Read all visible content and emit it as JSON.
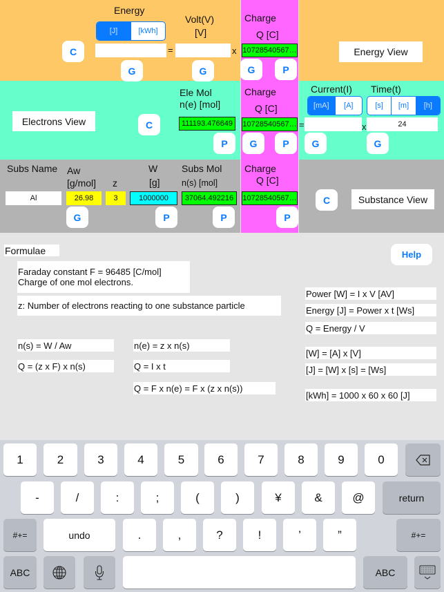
{
  "energy_section": {
    "title": "Energy",
    "unit_toggle": [
      {
        "label": "[J]",
        "selected": true
      },
      {
        "label": "[kWh]",
        "selected": false
      }
    ],
    "energy_value": "",
    "volt_label": "Volt(V)",
    "volt_unit": "[V]",
    "volt_value": "",
    "equals": "=",
    "times": "x",
    "clear_label": "C",
    "get_label": "G",
    "view_button": "Energy View"
  },
  "charge_column": {
    "label": "Charge",
    "unit": "Q [C]",
    "value": "10728540567…",
    "get_label": "G",
    "put_label": "P"
  },
  "electrons_section": {
    "view_button": "Electrons View",
    "clear_label": "C",
    "mol_label": "Ele Mol",
    "mol_unit": "n(e) [mol]",
    "mol_value": "111193.476649",
    "put_label": "P",
    "current_label": "Current(I)",
    "current_toggle": [
      {
        "label": "[mA]",
        "selected": true
      },
      {
        "label": "[A]",
        "selected": false
      }
    ],
    "current_value": "",
    "time_label": "Time(t)",
    "time_toggle": [
      {
        "label": "[s]",
        "selected": false
      },
      {
        "label": "[m]",
        "selected": false
      },
      {
        "label": "[h]",
        "selected": true
      }
    ],
    "time_value": "24",
    "equals": "=",
    "times": "x",
    "get_label": "G"
  },
  "substance_section": {
    "name_label": "Subs Name",
    "name_value": "Al",
    "aw_label": "Aw",
    "aw_unit": "[g/mol]",
    "aw_value": "26.98",
    "z_label": "z",
    "z_value": "3",
    "w_label": "W",
    "w_unit": "[g]",
    "w_value": "1000000",
    "mol_label": "Subs Mol",
    "mol_unit": "n(s) [mol]",
    "mol_value": "37064.492216",
    "get_label": "G",
    "put_label": "P",
    "clear_label": "C",
    "view_button": "Substance View"
  },
  "formulae": {
    "title": "Formulae",
    "help_label": "Help",
    "faraday_line1": "Faraday constant  F = 96485 [C/mol]",
    "faraday_line2": "Charge of one mol electrons.",
    "z_desc": "z: Number of electrons reacting to one substance particle",
    "left": [
      "n(s) = W / Aw",
      "Q = (z x F) x n(s)"
    ],
    "middle": [
      "n(e) = z x n(s)",
      "Q = I x t",
      "Q = F x n(e) = F x (z x n(s))"
    ],
    "right": [
      "Power [W] = I x V  [AV]",
      "Energy [J] =  Power x t  [Ws]",
      "Q = Energy  / V",
      "[W] = [A] x [V]",
      "[J] = [W] x [s] = [Ws]",
      "[kWh] = 1000 x 60 x 60 [J]"
    ]
  },
  "keyboard": {
    "row1": [
      "1",
      "2",
      "3",
      "4",
      "5",
      "6",
      "7",
      "8",
      "9",
      "0"
    ],
    "row2": [
      "-",
      "/",
      ":",
      ";",
      "(",
      ")",
      "¥",
      "&",
      "@"
    ],
    "return_label": "return",
    "row3_left": "#+=",
    "undo_label": "undo",
    "row3": [
      ".",
      ",",
      "?",
      "!",
      "’",
      "”"
    ],
    "row3_right": "#+=",
    "abc_left": "ABC",
    "abc_right": "ABC"
  }
}
